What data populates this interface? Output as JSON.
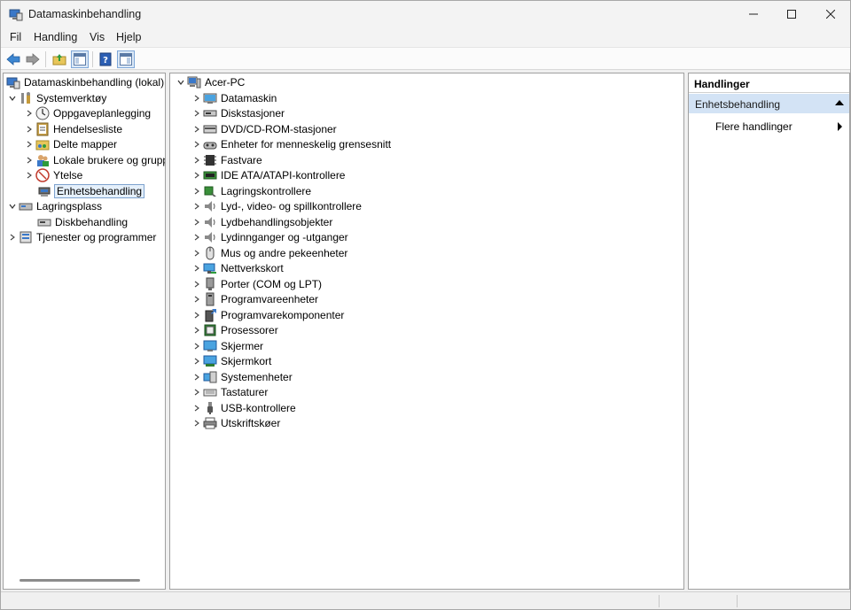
{
  "window": {
    "title": "Datamaskinbehandling"
  },
  "menu": [
    "Fil",
    "Handling",
    "Vis",
    "Hjelp"
  ],
  "left_tree": {
    "root": "Datamaskinbehandling (lokal)",
    "items": [
      {
        "label": "Systemverktøy",
        "icon": "tools-icon"
      },
      {
        "label": "Oppgaveplanlegging",
        "icon": "clock-icon"
      },
      {
        "label": "Hendelsesliste",
        "icon": "event-log-icon"
      },
      {
        "label": "Delte mapper",
        "icon": "shared-folder-icon"
      },
      {
        "label": "Lokale brukere og grupp",
        "icon": "users-icon"
      },
      {
        "label": "Ytelse",
        "icon": "performance-icon"
      },
      {
        "label": "Enhetsbehandling",
        "icon": "device-manager-icon"
      },
      {
        "label": "Lagringsplass",
        "icon": "storage-icon"
      },
      {
        "label": "Diskbehandling",
        "icon": "disk-icon"
      },
      {
        "label": "Tjenester og programmer",
        "icon": "services-icon"
      }
    ]
  },
  "device_tree": {
    "root": "Acer-PC",
    "categories": [
      "Datamaskin",
      "Diskstasjoner",
      "DVD/CD-ROM-stasjoner",
      "Enheter for menneskelig grensesnitt",
      "Fastvare",
      "IDE ATA/ATAPI-kontrollere",
      "Lagringskontrollere",
      "Lyd-, video- og spillkontrollere",
      "Lydbehandlingsobjekter",
      "Lydinnganger og -utganger",
      "Mus og andre pekeenheter",
      "Nettverkskort",
      "Porter (COM og LPT)",
      "Programvareenheter",
      "Programvarekomponenter",
      "Prosessorer",
      "Skjermer",
      "Skjermkort",
      "Systemenheter",
      "Tastaturer",
      "USB-kontrollere",
      "Utskriftskøer"
    ]
  },
  "actions": {
    "header": "Handlinger",
    "section": "Enhetsbehandling",
    "item": "Flere handlinger"
  },
  "colors": {
    "selection": "#e5f0fb",
    "actions_section": "#d3e3f5",
    "accent_blue": "#3a78c9"
  }
}
